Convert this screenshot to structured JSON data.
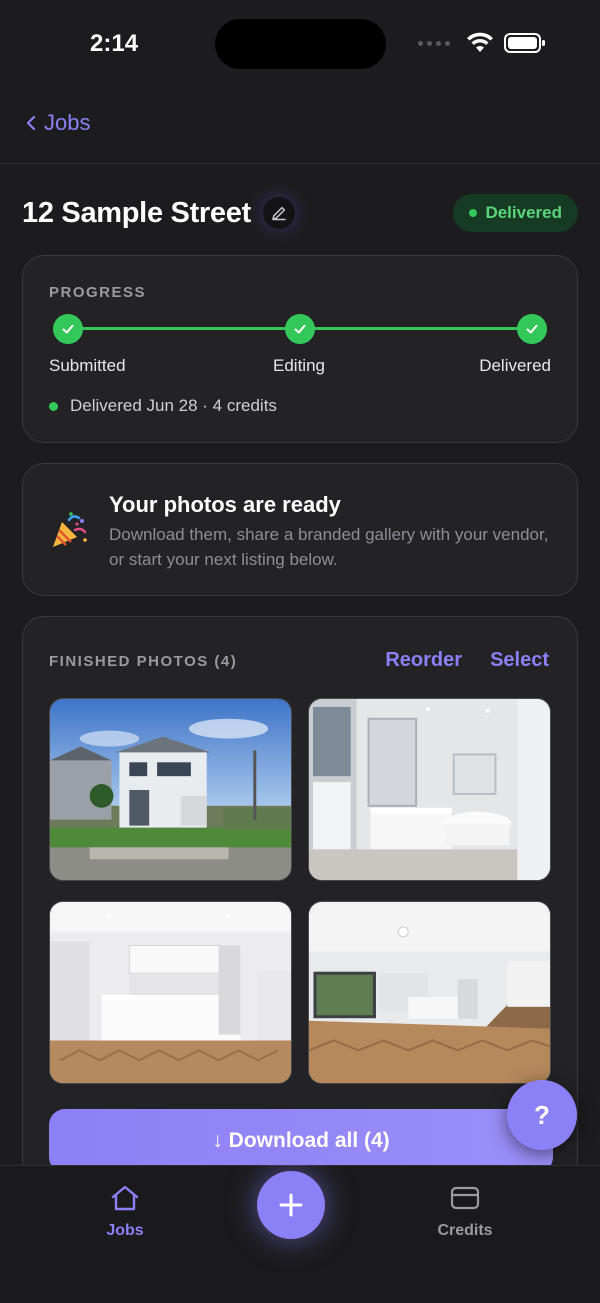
{
  "status_bar": {
    "time": "2:14"
  },
  "nav": {
    "back_label": "Jobs"
  },
  "header": {
    "title": "12 Sample Street",
    "status_badge": "Delivered"
  },
  "progress": {
    "heading": "PROGRESS",
    "steps": [
      {
        "label": "Submitted",
        "done": true
      },
      {
        "label": "Editing",
        "done": true
      },
      {
        "label": "Delivered",
        "done": true
      }
    ],
    "status_text": "Delivered Jun 28 · 4 credits"
  },
  "ready": {
    "title": "Your photos are ready",
    "text": "Download them, share a branded gallery with your vendor, or start your next listing below."
  },
  "photos": {
    "heading": "FINISHED PHOTOS (4)",
    "reorder_label": "Reorder",
    "select_label": "Select",
    "download_label": "↓ Download all (4)"
  },
  "help": {
    "label": "?"
  },
  "tabbar": {
    "jobs_label": "Jobs",
    "credits_label": "Credits"
  },
  "colors": {
    "accent": "#8c80f6",
    "success": "#34c759",
    "background": "#1c1c1e",
    "card": "#232326"
  }
}
